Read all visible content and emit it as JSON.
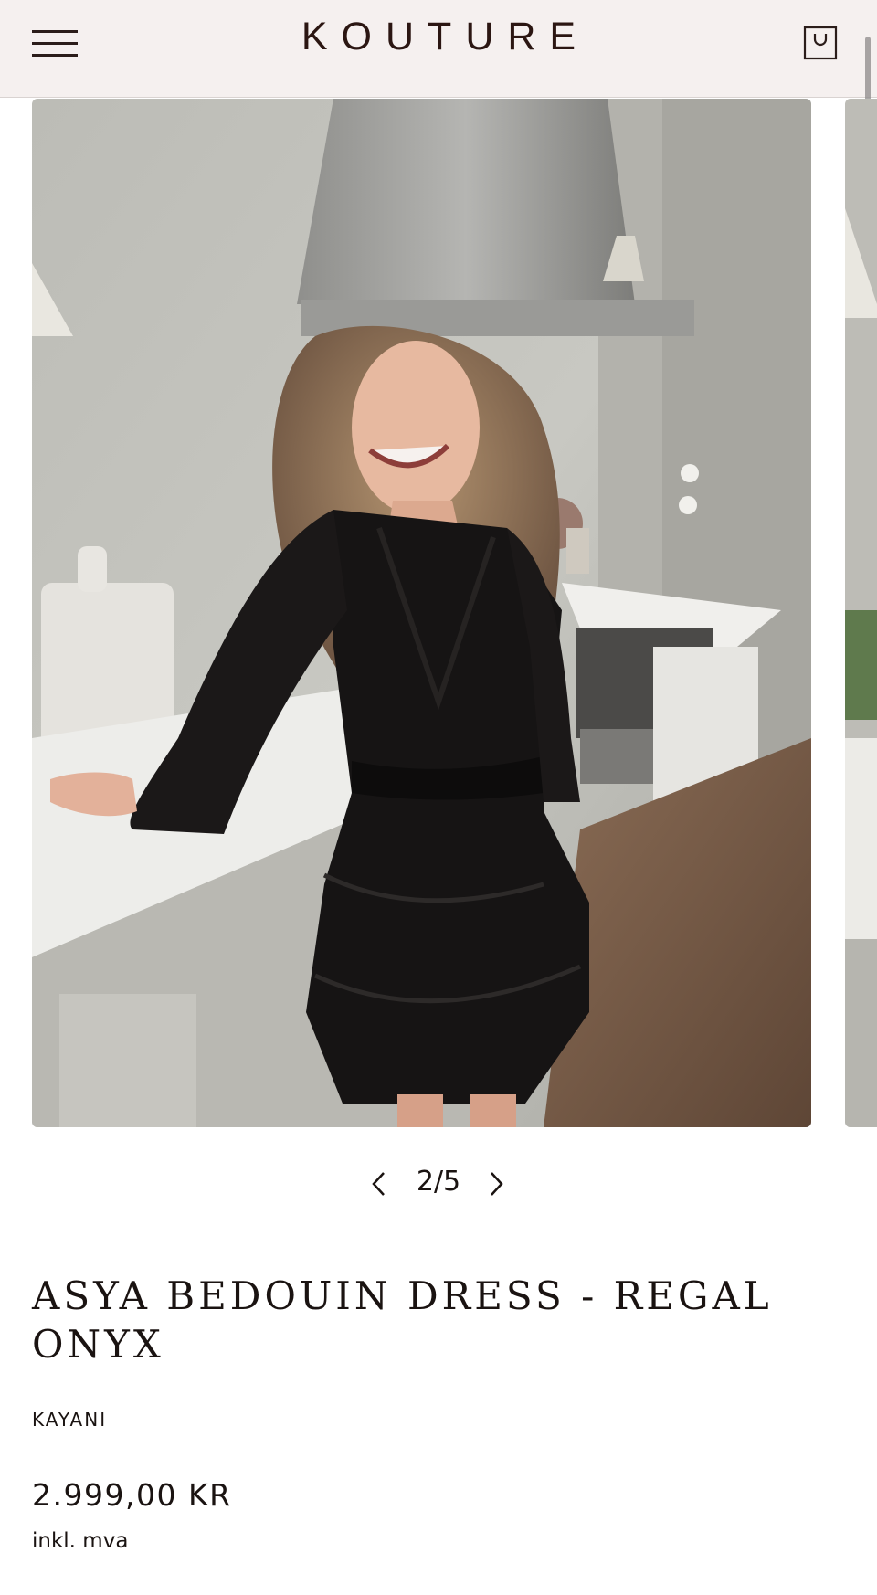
{
  "header": {
    "logo": "KOUTURE",
    "menu_icon": "hamburger-menu-icon",
    "cart_icon": "shopping-bag-icon"
  },
  "gallery": {
    "image_description_icon": "product-photo",
    "counter": "2/5",
    "prev_icon": "chevron-left-icon",
    "next_icon": "chevron-right-icon"
  },
  "product": {
    "title": "ASYA BEDOUIN DRESS - REGAL ONYX",
    "brand": "KAYANI",
    "price": "2.999,00 KR",
    "vat_note": "inkl. mva"
  },
  "colors": {
    "header_bg": "#f5f0ef",
    "text": "#1a1311",
    "dress": "#141212"
  }
}
